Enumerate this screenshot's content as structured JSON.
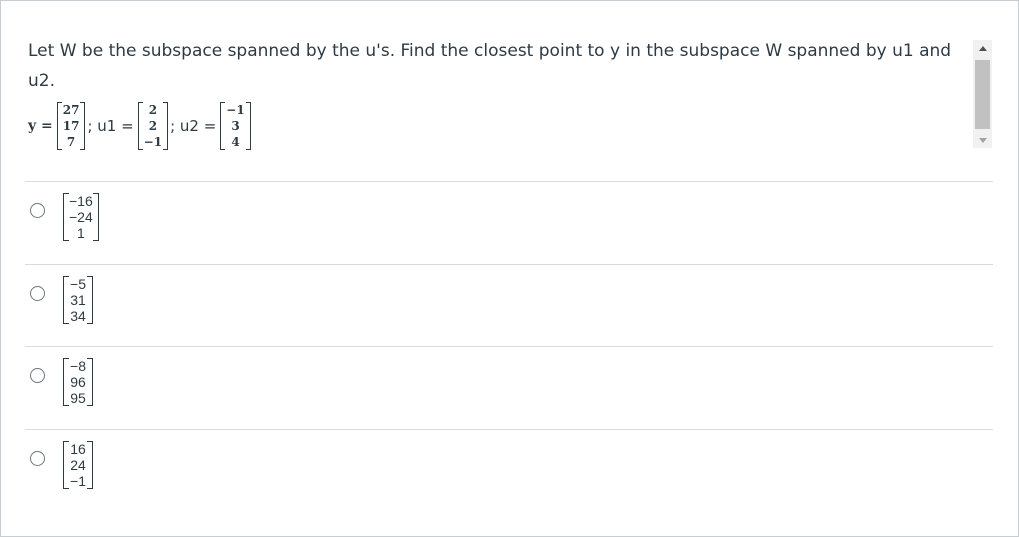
{
  "question": {
    "text": "Let W be the subspace spanned by the u's. Find the closest point to y in the subspace W spanned by u1 and u2."
  },
  "equation": {
    "y_label": "y =",
    "y": [
      "27",
      "17",
      "7"
    ],
    "sep1": "; u1 =",
    "u1": [
      "2",
      "2",
      "−1"
    ],
    "sep2": "; u2 =",
    "u2": [
      "−1",
      "3",
      "4"
    ]
  },
  "options": [
    {
      "values": [
        "−16",
        "−24",
        "1"
      ]
    },
    {
      "values": [
        "−5",
        "31",
        "34"
      ]
    },
    {
      "values": [
        "−8",
        "96",
        "95"
      ]
    },
    {
      "values": [
        "16",
        "24",
        "−1"
      ]
    }
  ]
}
